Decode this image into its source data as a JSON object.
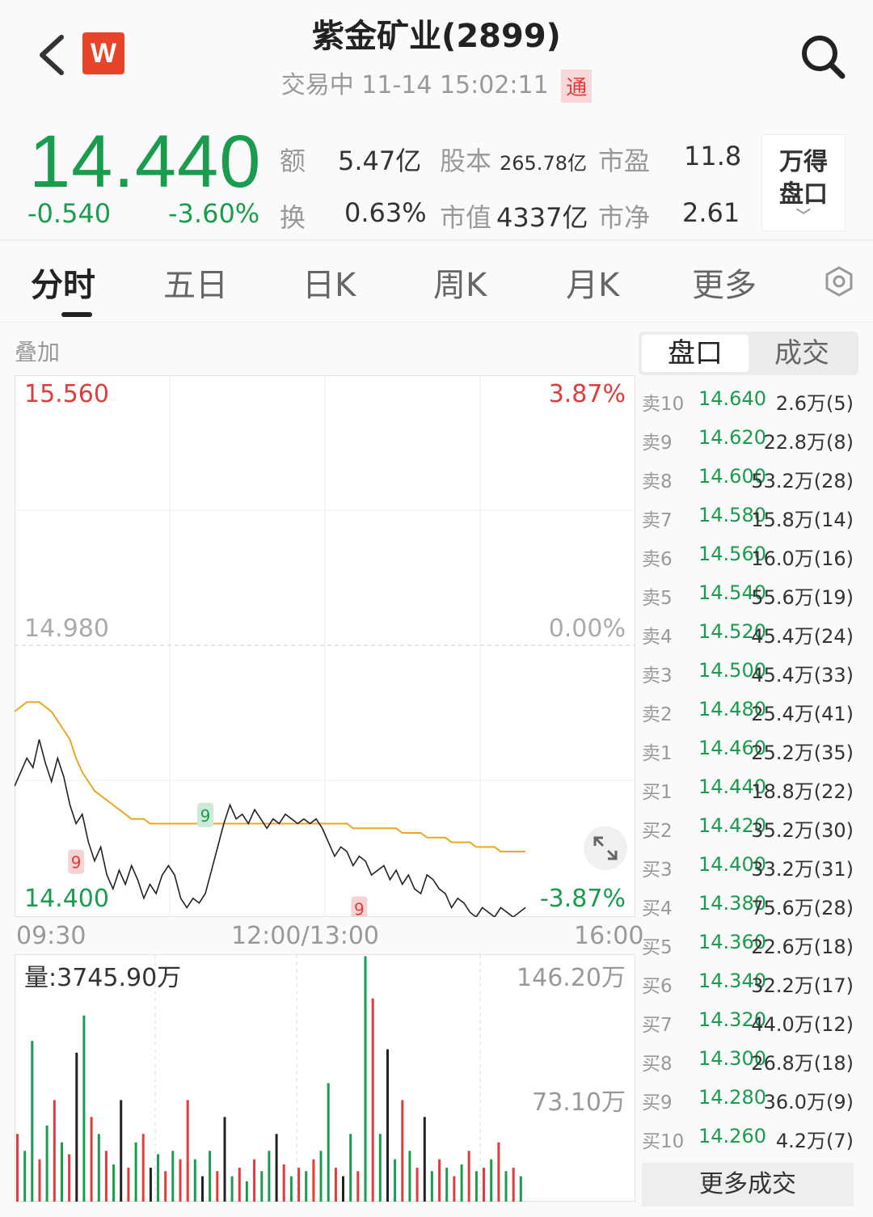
{
  "header": {
    "title": "紫金矿业(2899)",
    "status": "交易中",
    "datetime": "11-14 15:02:11",
    "tong_badge": "通",
    "logo_text": "W"
  },
  "quote": {
    "price": "14.440",
    "change": "-0.540",
    "change_pct": "-3.60%",
    "stats": [
      {
        "label": "额",
        "value": "5.47亿"
      },
      {
        "label": "股本",
        "value": "265.78亿"
      },
      {
        "label": "市盈",
        "value": "11.8"
      },
      {
        "label": "换",
        "value": "0.63%"
      },
      {
        "label": "市值",
        "value": "4337亿"
      },
      {
        "label": "市净",
        "value": "2.61"
      }
    ],
    "wande_line1": "万得",
    "wande_line2": "盘口"
  },
  "tabs": [
    {
      "label": "分时",
      "active": true
    },
    {
      "label": "五日",
      "active": false
    },
    {
      "label": "日K",
      "active": false
    },
    {
      "label": "周K",
      "active": false
    },
    {
      "label": "月K",
      "active": false
    },
    {
      "label": "更多",
      "active": false
    }
  ],
  "overlay_label": "叠加",
  "colors": {
    "up": "#e03c3c",
    "down": "#1a9c4e",
    "avg": "#e8a824",
    "line": "#222222"
  },
  "chart_data": {
    "type": "line",
    "y_labels": {
      "top": "15.560",
      "mid": "14.980",
      "bottom": "14.400"
    },
    "pct_labels": {
      "top": "3.87%",
      "mid": "0.00%",
      "bottom": "-3.87%"
    },
    "ylim": [
      14.4,
      15.56
    ],
    "prev_close": 14.98,
    "x_labels": [
      "09:30",
      "12:00/13:00",
      "16:00"
    ],
    "markers": [
      "9",
      "9",
      "9"
    ],
    "price": [
      14.68,
      14.71,
      14.74,
      14.72,
      14.78,
      14.73,
      14.69,
      14.74,
      14.7,
      14.64,
      14.6,
      14.62,
      14.56,
      14.52,
      14.55,
      14.49,
      14.46,
      14.5,
      14.47,
      14.51,
      14.48,
      14.44,
      14.47,
      14.45,
      14.49,
      14.51,
      14.49,
      14.44,
      14.42,
      14.44,
      14.43,
      14.45,
      14.5,
      14.55,
      14.6,
      14.64,
      14.61,
      14.62,
      14.6,
      14.63,
      14.61,
      14.59,
      14.61,
      14.6,
      14.62,
      14.61,
      14.6,
      14.61,
      14.6,
      14.61,
      14.59,
      14.56,
      14.53,
      14.55,
      14.54,
      14.51,
      14.53,
      14.52,
      14.49,
      14.5,
      14.51,
      14.48,
      14.5,
      14.47,
      14.49,
      14.46,
      14.45,
      14.49,
      14.48,
      14.46,
      14.45,
      14.42,
      14.44,
      14.43,
      14.41,
      14.4,
      14.42,
      14.41,
      14.4,
      14.42,
      14.41,
      14.4,
      14.41,
      14.42
    ],
    "avg": [
      14.84,
      14.85,
      14.86,
      14.86,
      14.86,
      14.85,
      14.84,
      14.82,
      14.8,
      14.78,
      14.74,
      14.71,
      14.69,
      14.67,
      14.66,
      14.65,
      14.64,
      14.63,
      14.62,
      14.61,
      14.61,
      14.61,
      14.6,
      14.6,
      14.6,
      14.6,
      14.6,
      14.6,
      14.6,
      14.6,
      14.6,
      14.6,
      14.6,
      14.6,
      14.6,
      14.6,
      14.6,
      14.6,
      14.6,
      14.6,
      14.6,
      14.6,
      14.6,
      14.6,
      14.6,
      14.6,
      14.6,
      14.6,
      14.6,
      14.6,
      14.6,
      14.6,
      14.6,
      14.6,
      14.6,
      14.59,
      14.59,
      14.59,
      14.59,
      14.59,
      14.59,
      14.59,
      14.59,
      14.58,
      14.58,
      14.58,
      14.58,
      14.57,
      14.57,
      14.57,
      14.57,
      14.56,
      14.56,
      14.56,
      14.56,
      14.55,
      14.55,
      14.55,
      14.55,
      14.54,
      14.54,
      14.54,
      14.54,
      14.54
    ],
    "volume_label": "量:3745.90万",
    "volume_axis": {
      "top": "146.20万",
      "mid": "73.10万"
    },
    "volume_max": 146.2,
    "volume": [
      {
        "v": 40,
        "c": "up"
      },
      {
        "v": 30,
        "c": "down"
      },
      {
        "v": 95,
        "c": "down"
      },
      {
        "v": 25,
        "c": "up"
      },
      {
        "v": 45,
        "c": "down"
      },
      {
        "v": 60,
        "c": "up"
      },
      {
        "v": 35,
        "c": "down"
      },
      {
        "v": 28,
        "c": "up"
      },
      {
        "v": 88,
        "c": "line"
      },
      {
        "v": 110,
        "c": "down"
      },
      {
        "v": 50,
        "c": "up"
      },
      {
        "v": 40,
        "c": "down"
      },
      {
        "v": 30,
        "c": "up"
      },
      {
        "v": 22,
        "c": "down"
      },
      {
        "v": 60,
        "c": "line"
      },
      {
        "v": 20,
        "c": "up"
      },
      {
        "v": 35,
        "c": "down"
      },
      {
        "v": 40,
        "c": "up"
      },
      {
        "v": 20,
        "c": "line"
      },
      {
        "v": 28,
        "c": "down"
      },
      {
        "v": 18,
        "c": "up"
      },
      {
        "v": 30,
        "c": "down"
      },
      {
        "v": 25,
        "c": "up"
      },
      {
        "v": 60,
        "c": "up"
      },
      {
        "v": 25,
        "c": "down"
      },
      {
        "v": 15,
        "c": "line"
      },
      {
        "v": 30,
        "c": "down"
      },
      {
        "v": 18,
        "c": "up"
      },
      {
        "v": 50,
        "c": "line"
      },
      {
        "v": 15,
        "c": "down"
      },
      {
        "v": 20,
        "c": "up"
      },
      {
        "v": 12,
        "c": "down"
      },
      {
        "v": 25,
        "c": "up"
      },
      {
        "v": 18,
        "c": "down"
      },
      {
        "v": 30,
        "c": "down"
      },
      {
        "v": 40,
        "c": "line"
      },
      {
        "v": 22,
        "c": "up"
      },
      {
        "v": 15,
        "c": "down"
      },
      {
        "v": 20,
        "c": "up"
      },
      {
        "v": 18,
        "c": "down"
      },
      {
        "v": 25,
        "c": "up"
      },
      {
        "v": 30,
        "c": "down"
      },
      {
        "v": 70,
        "c": "down"
      },
      {
        "v": 20,
        "c": "up"
      },
      {
        "v": 15,
        "c": "line"
      },
      {
        "v": 40,
        "c": "down"
      },
      {
        "v": 18,
        "c": "up"
      },
      {
        "v": 145,
        "c": "down"
      },
      {
        "v": 120,
        "c": "up"
      },
      {
        "v": 40,
        "c": "down"
      },
      {
        "v": 90,
        "c": "line"
      },
      {
        "v": 25,
        "c": "down"
      },
      {
        "v": 60,
        "c": "up"
      },
      {
        "v": 30,
        "c": "down"
      },
      {
        "v": 20,
        "c": "up"
      },
      {
        "v": 50,
        "c": "line"
      },
      {
        "v": 18,
        "c": "down"
      },
      {
        "v": 25,
        "c": "up"
      },
      {
        "v": 20,
        "c": "down"
      },
      {
        "v": 15,
        "c": "up"
      },
      {
        "v": 22,
        "c": "down"
      },
      {
        "v": 30,
        "c": "up"
      },
      {
        "v": 18,
        "c": "down"
      },
      {
        "v": 20,
        "c": "up"
      },
      {
        "v": 25,
        "c": "down"
      },
      {
        "v": 35,
        "c": "up"
      },
      {
        "v": 18,
        "c": "down"
      },
      {
        "v": 20,
        "c": "up"
      },
      {
        "v": 15,
        "c": "down"
      }
    ]
  },
  "expand_icon": "expand-arrows-icon",
  "order_book": {
    "tabs": [
      "盘口",
      "成交"
    ],
    "rows": [
      {
        "level": "卖10",
        "price": "14.640",
        "vol": "2.6万(5)"
      },
      {
        "level": "卖9",
        "price": "14.620",
        "vol": "22.8万(8)"
      },
      {
        "level": "卖8",
        "price": "14.600",
        "vol": "53.2万(28)"
      },
      {
        "level": "卖7",
        "price": "14.580",
        "vol": "15.8万(14)"
      },
      {
        "level": "卖6",
        "price": "14.560",
        "vol": "16.0万(16)"
      },
      {
        "level": "卖5",
        "price": "14.540",
        "vol": "55.6万(19)"
      },
      {
        "level": "卖4",
        "price": "14.520",
        "vol": "45.4万(24)"
      },
      {
        "level": "卖3",
        "price": "14.500",
        "vol": "45.4万(33)"
      },
      {
        "level": "卖2",
        "price": "14.480",
        "vol": "25.4万(41)"
      },
      {
        "level": "卖1",
        "price": "14.460",
        "vol": "25.2万(35)"
      },
      {
        "level": "买1",
        "price": "14.440",
        "vol": "18.8万(22)"
      },
      {
        "level": "买2",
        "price": "14.420",
        "vol": "35.2万(30)"
      },
      {
        "level": "买3",
        "price": "14.400",
        "vol": "33.2万(31)"
      },
      {
        "level": "买4",
        "price": "14.380",
        "vol": "75.6万(28)"
      },
      {
        "level": "买5",
        "price": "14.360",
        "vol": "22.6万(18)"
      },
      {
        "level": "买6",
        "price": "14.340",
        "vol": "32.2万(17)"
      },
      {
        "level": "买7",
        "price": "14.320",
        "vol": "44.0万(12)"
      },
      {
        "level": "买8",
        "price": "14.300",
        "vol": "26.8万(18)"
      },
      {
        "level": "买9",
        "price": "14.280",
        "vol": "36.0万(9)"
      },
      {
        "level": "买10",
        "price": "14.260",
        "vol": "4.2万(7)"
      }
    ],
    "more_label": "更多成交"
  }
}
